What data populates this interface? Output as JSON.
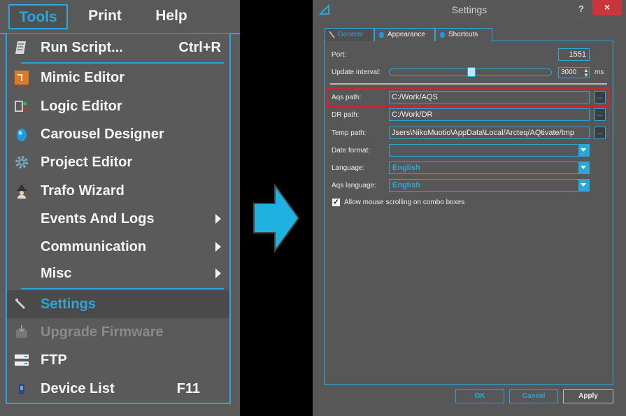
{
  "menubar": {
    "tools": "Tools",
    "print": "Print",
    "help": "Help"
  },
  "menu": {
    "items": [
      {
        "label": "Run Script...",
        "shortcut": "Ctrl+R",
        "icon": "script-icon"
      },
      {
        "label": "Mimic Editor",
        "icon": "mimic-editor-icon"
      },
      {
        "label": "Logic Editor",
        "icon": "logic-editor-icon"
      },
      {
        "label": "Carousel Designer",
        "icon": "carousel-icon"
      },
      {
        "label": "Project Editor",
        "icon": "gear-icon"
      },
      {
        "label": "Trafo Wizard",
        "icon": "wizard-icon"
      },
      {
        "label": "Events And Logs",
        "submenu": true
      },
      {
        "label": "Communication",
        "submenu": true
      },
      {
        "label": "Misc",
        "submenu": true
      },
      {
        "label": "Settings",
        "icon": "wrench-icon",
        "active": true
      },
      {
        "label": "Upgrade Firmware",
        "icon": "firmware-icon",
        "disabled": true
      },
      {
        "label": "FTP",
        "icon": "ftp-icon"
      },
      {
        "label": "Device List",
        "shortcut": "F11",
        "icon": "device-icon"
      }
    ]
  },
  "dialog": {
    "title": "Settings",
    "help": "?",
    "close": "×",
    "tabs": [
      "General",
      "Appearance",
      "Shortcuts"
    ],
    "port_label": "Port:",
    "port_value": "1551",
    "interval_label": "Update interval:",
    "interval_value": "3000",
    "interval_unit": "ms",
    "aqs_label": "Aqs path:",
    "aqs_value": "C:/Work/AQS",
    "dr_label": "DR path:",
    "dr_value": "C:/Work/DR",
    "temp_label": "Temp path:",
    "temp_value": "Jsers\\NikoMuotio\\AppData\\Local/Arcteq/AQtivate/tmp",
    "browse": "...",
    "date_label": "Date format:",
    "date_value": "",
    "language_label": "Language:",
    "language_value": "English",
    "aqs_language_label": "Aqs language:",
    "aqs_language_value": "English",
    "checkbox_label": "Allow mouse scrolling on combo boxes",
    "checkbox_checked": true,
    "ok": "OK",
    "cancel": "Cancel",
    "apply": "Apply"
  },
  "colors": {
    "accent": "#2aa7d8",
    "highlight": "#d1232a",
    "close": "#c8363b"
  }
}
